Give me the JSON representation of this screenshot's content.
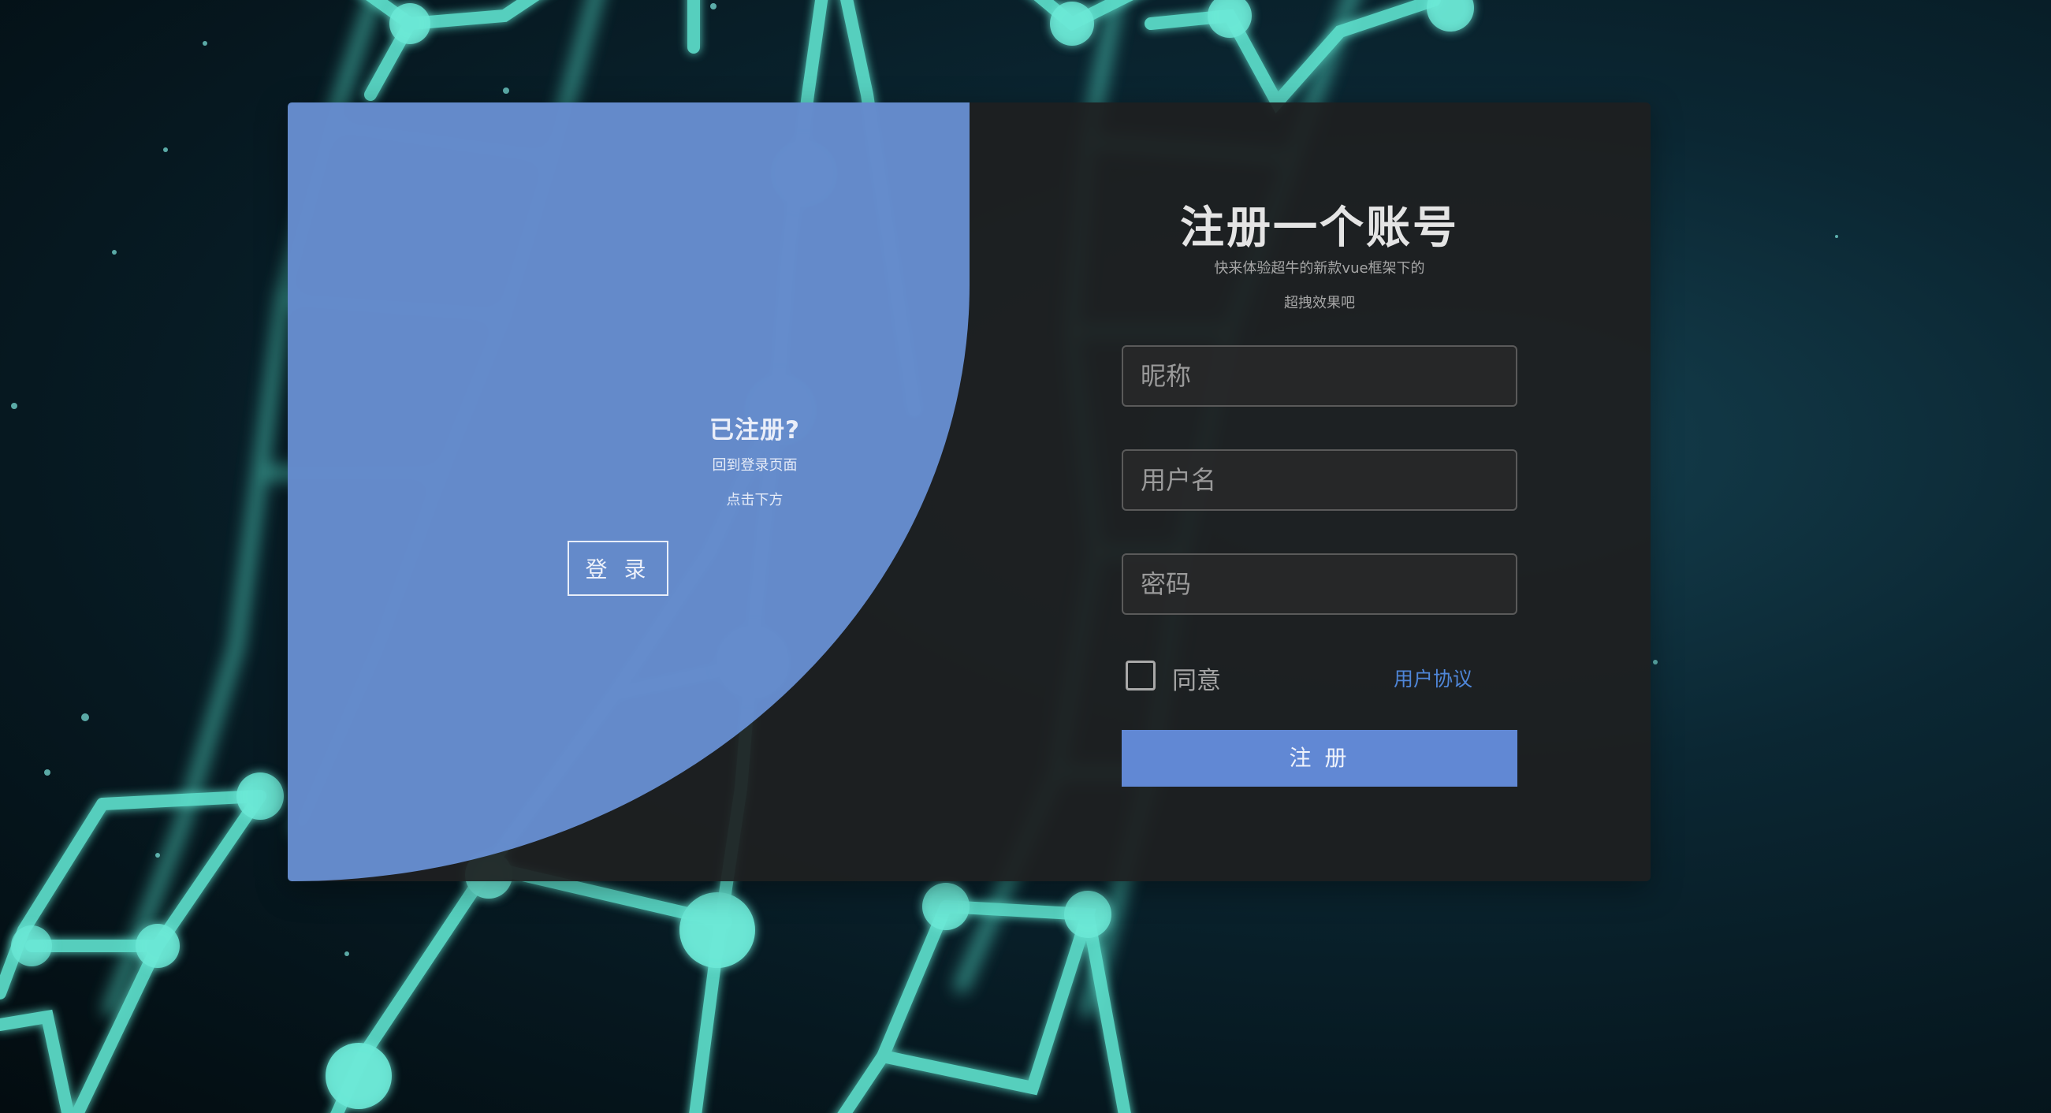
{
  "left_panel": {
    "title": "已注册?",
    "subtitle_line1": "回到登录页面",
    "subtitle_line2": "点击下方",
    "login_button_label": "登 录"
  },
  "right_panel": {
    "title": "注册一个账号",
    "subtitle_line1": "快来体验超牛的新款vue框架下的",
    "subtitle_line2": "超拽效果吧",
    "fields": {
      "nickname_placeholder": "昵称",
      "username_placeholder": "用户名",
      "password_placeholder": "密码"
    },
    "agree_label": "同意",
    "agreement_link": "用户协议",
    "register_button_label": "注 册"
  },
  "colors": {
    "accent_blue": "#6188d4",
    "panel_blue": "#709ce6",
    "panel_dark": "#1e1f20",
    "link_blue": "#4f86d8",
    "network_cyan": "#5fe3cf"
  }
}
